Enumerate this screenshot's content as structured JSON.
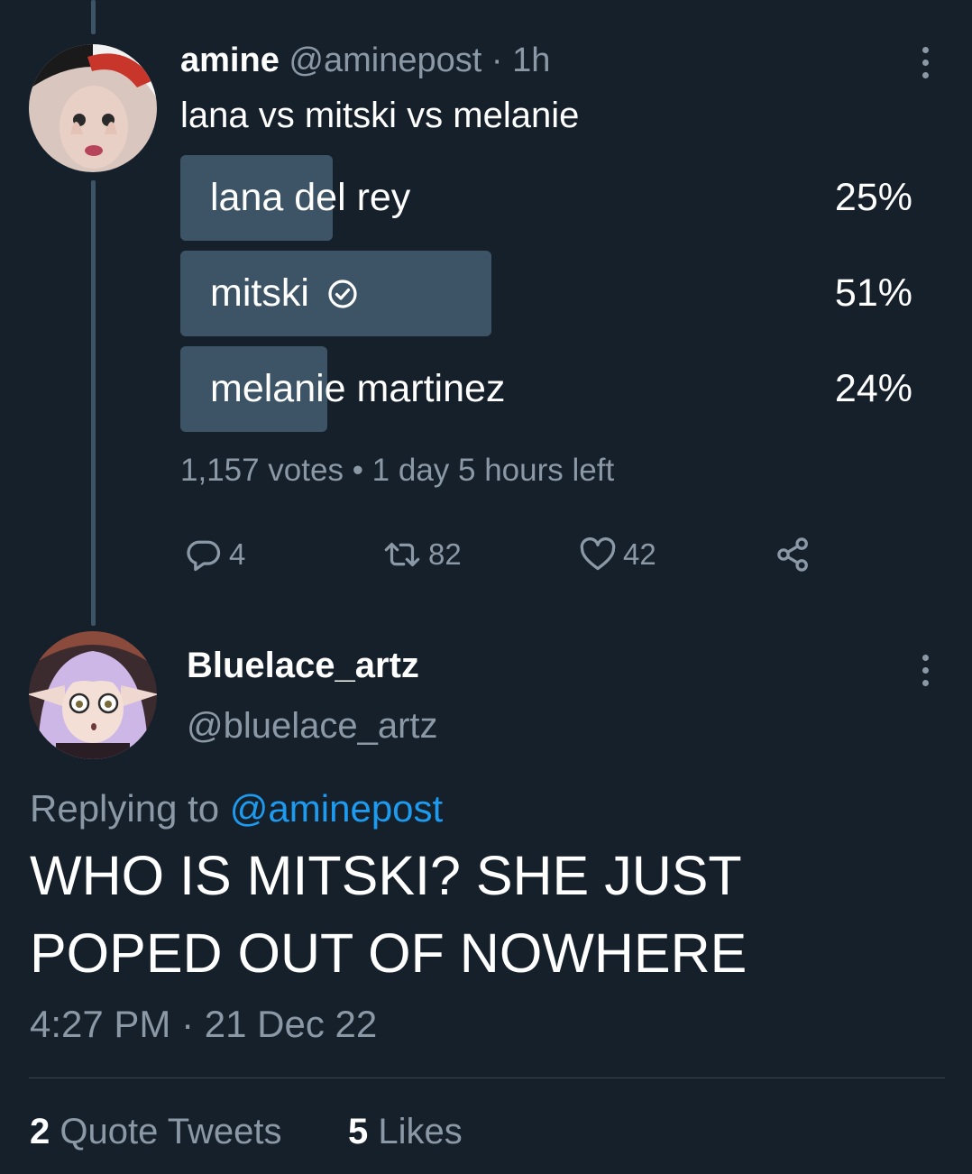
{
  "original_tweet": {
    "display_name": "amine",
    "handle": "@aminepost",
    "separator": "·",
    "time_ago": "1h",
    "text": "lana vs mitski vs melanie",
    "poll": {
      "options": [
        {
          "label": "lana del rey",
          "percent_label": "25%",
          "percent": 25,
          "selected": false
        },
        {
          "label": "mitski",
          "percent_label": "51%",
          "percent": 51,
          "selected": true
        },
        {
          "label": "melanie martinez",
          "percent_label": "24%",
          "percent": 24,
          "selected": false
        }
      ],
      "summary": "1,157 votes • 1 day 5 hours left"
    },
    "actions": {
      "replies": "4",
      "retweets": "82",
      "likes": "42"
    }
  },
  "reply_tweet": {
    "display_name": "Bluelace_artz",
    "handle": "@bluelace_artz",
    "replying_prefix": "Replying to ",
    "replying_handle": "@aminepost",
    "text_line1": "WHO IS MITSKI? SHE JUST",
    "text_line2": "POPED OUT OF NOWHERE",
    "timestamp": "4:27 PM · 21 Dec 22",
    "stats": {
      "quote_count": "2",
      "quote_label": "Quote Tweets",
      "like_count": "5",
      "like_label": "Likes"
    }
  },
  "colors": {
    "background": "#15202b",
    "secondary_text": "#8b98a5",
    "link": "#1d9bf0",
    "poll_bar": "#3d5466",
    "divider": "#38444d"
  }
}
